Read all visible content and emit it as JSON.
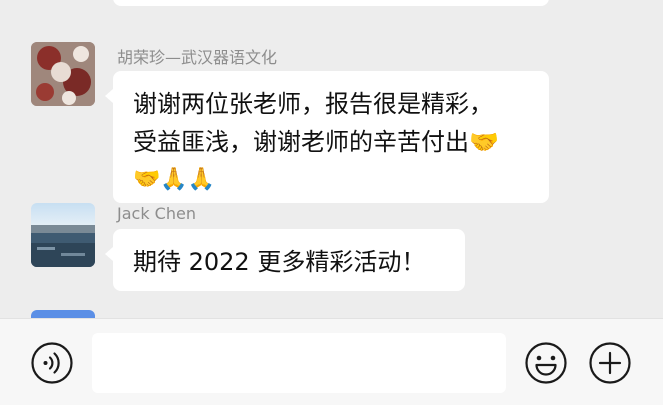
{
  "messages": [
    {
      "sender": "胡荣珍—武汉器语文化",
      "lines": [
        "谢谢两位张老师，报告很是精彩，",
        "受益匪浅，谢谢老师的辛苦付出🤝",
        "🤝🙏🙏"
      ]
    },
    {
      "sender": "Jack Chen",
      "lines": [
        "期待 2022 更多精彩活动！"
      ]
    }
  ],
  "input": {
    "value": "",
    "placeholder": ""
  },
  "icons": {
    "voice": "voice-icon",
    "emoji": "emoji-icon",
    "plus": "plus-icon"
  },
  "colors": {
    "background": "#ededed",
    "bubble": "#ffffff",
    "sender_name": "#8d8d8d",
    "input_bar": "#f7f7f7"
  }
}
